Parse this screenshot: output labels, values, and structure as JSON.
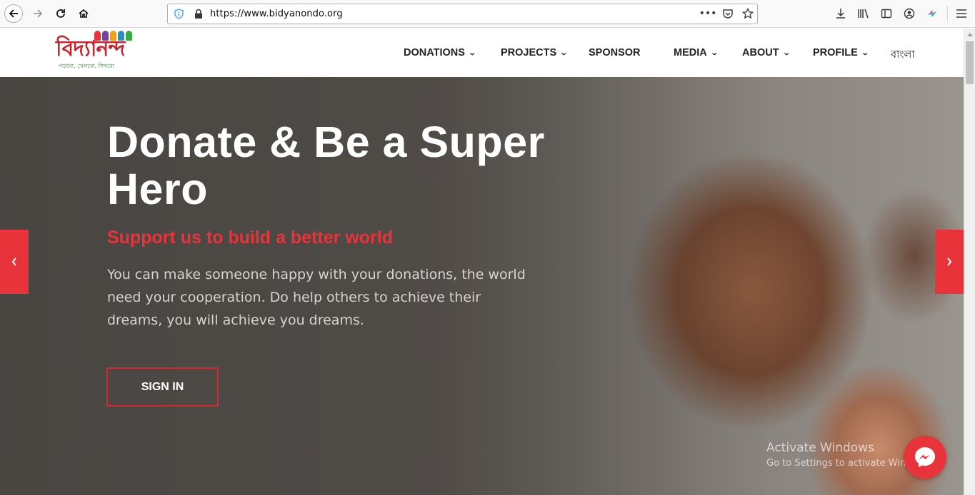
{
  "browser": {
    "url": "https://www.bidyanondo.org"
  },
  "logo": {
    "wordmark": "বিদ্যানন্দ",
    "tagline": "পড়বো, খেলবো, শিখবো"
  },
  "nav": {
    "donations": "DONATIONS",
    "projects": "PROJECTS",
    "sponsor": "SPONSOR",
    "media": "MEDIA",
    "about": "ABOUT",
    "profile": "PROFILE",
    "language": "বাংলা"
  },
  "hero": {
    "title": "Donate & Be a Super Hero",
    "subtitle": "Support us to build a better world",
    "text": "You can make someone happy with your donations, the world need your cooperation. Do help others to achieve their dreams, you will achieve you dreams.",
    "signin_label": "SIGN IN"
  },
  "watermark": {
    "line1": "Activate Windows",
    "line2": "Go to Settings to activate Windows."
  },
  "colors": {
    "accent": "#e8333b",
    "brand_red": "#c8242b",
    "nav_text": "#222222"
  },
  "icons": {
    "back": "arrow-left-icon",
    "forward": "arrow-right-icon",
    "reload": "reload-icon",
    "home": "home-icon",
    "messenger": "messenger-icon"
  }
}
